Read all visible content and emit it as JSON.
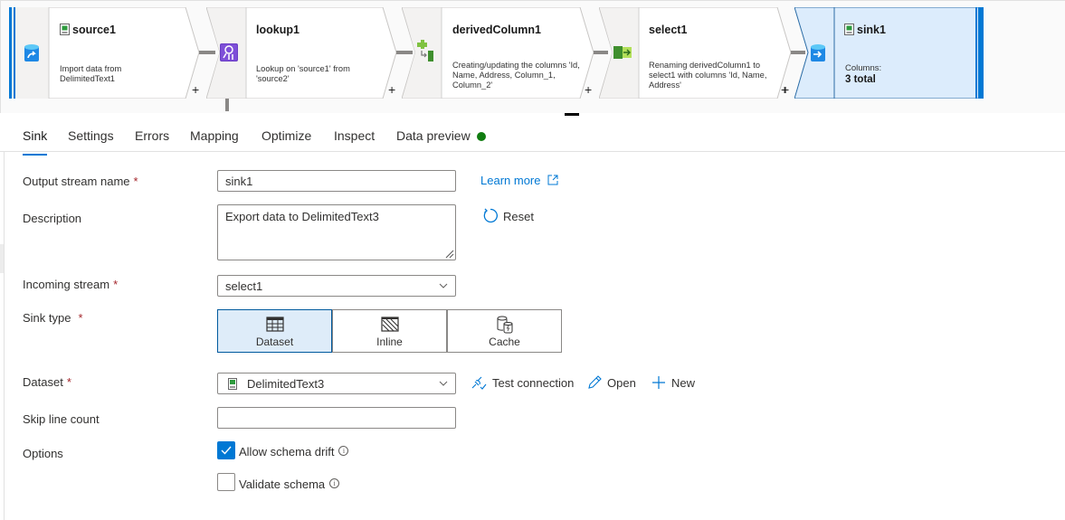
{
  "pipeline": {
    "nodes": [
      {
        "id": "source1",
        "title": "source1",
        "description": "Import data from DelimitedText1",
        "icon": "source-database-icon",
        "title_icon": "csv-file-icon"
      },
      {
        "id": "lookup1",
        "title": "lookup1",
        "description": "Lookup on 'source1' from 'source2'",
        "icon": "lookup-icon"
      },
      {
        "id": "derivedColumn1",
        "title": "derivedColumn1",
        "description": "Creating/updating the columns 'Id, Name, Address, Column_1, Column_2'",
        "icon": "derived-column-icon"
      },
      {
        "id": "select1",
        "title": "select1",
        "description": "Renaming derivedColumn1 to select1 with columns 'Id, Name, Address'",
        "icon": "select-icon"
      },
      {
        "id": "sink1",
        "title": "sink1",
        "columns_label": "Columns:",
        "columns_value": "3 total",
        "icon": "sink-database-icon",
        "title_icon": "csv-file-icon",
        "selected": true
      }
    ],
    "add_label": "+"
  },
  "tabs": [
    {
      "label": "Sink",
      "active": true
    },
    {
      "label": "Settings"
    },
    {
      "label": "Errors"
    },
    {
      "label": "Mapping"
    },
    {
      "label": "Optimize"
    },
    {
      "label": "Inspect"
    },
    {
      "label": "Data preview",
      "status": "green-dot"
    }
  ],
  "form": {
    "output_stream_name": {
      "label": "Output stream name",
      "required": "*",
      "value": "sink1"
    },
    "learn_more": "Learn more",
    "description": {
      "label": "Description",
      "value": "Export data to DelimitedText3"
    },
    "reset": "Reset",
    "incoming_stream": {
      "label": "Incoming stream",
      "required": "*",
      "value": "select1"
    },
    "sink_type": {
      "label": "Sink type",
      "required": "*",
      "options": [
        {
          "label": "Dataset",
          "icon": "table-icon",
          "selected": true
        },
        {
          "label": "Inline",
          "icon": "inline-hatch-icon"
        },
        {
          "label": "Cache",
          "icon": "cache-icon"
        }
      ]
    },
    "dataset": {
      "label": "Dataset",
      "required": "*",
      "value": "DelimitedText3"
    },
    "test_connection": "Test connection",
    "open": "Open",
    "new": "New",
    "skip_line_count": {
      "label": "Skip line count",
      "value": ""
    },
    "options": {
      "label": "Options",
      "allow_schema_drift": {
        "label": "Allow schema drift",
        "checked": true
      },
      "validate_schema": {
        "label": "Validate schema",
        "checked": false
      }
    }
  },
  "colors": {
    "accent": "#0078d4",
    "status_ok": "#107c10",
    "selected_bg": "#deecf9"
  }
}
